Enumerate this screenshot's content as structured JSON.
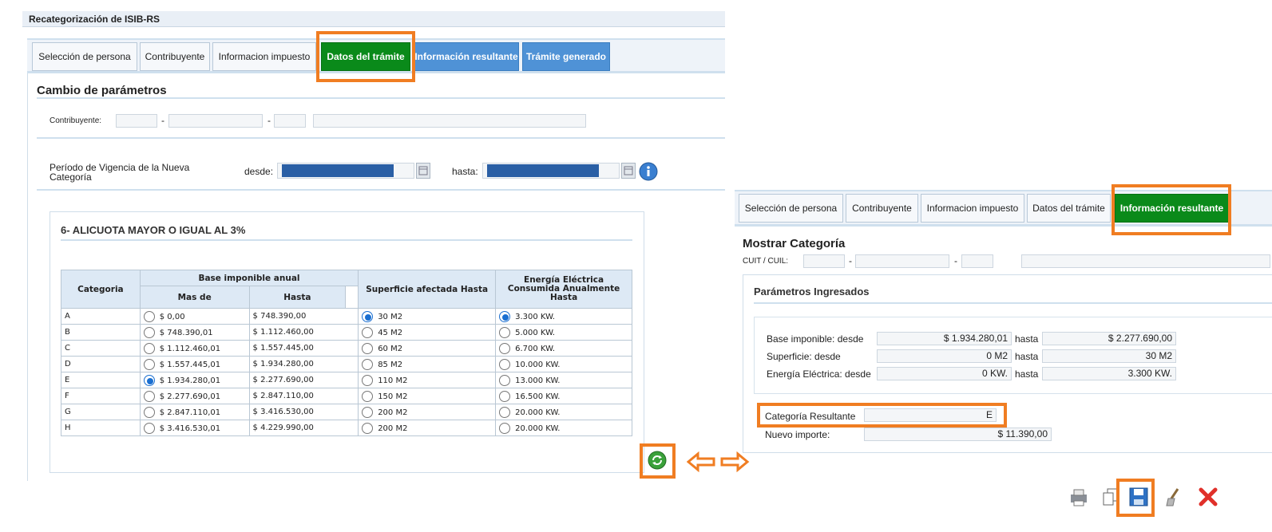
{
  "window_title": "Recategorización de ISIB-RS",
  "left": {
    "tabs": [
      {
        "label": "Selección de persona",
        "state": "normal"
      },
      {
        "label": "Contribuyente",
        "state": "normal"
      },
      {
        "label": "Informacion impuesto",
        "state": "normal"
      },
      {
        "label": "Datos del trámite",
        "state": "active"
      },
      {
        "label": "Información resultante",
        "state": "blue"
      },
      {
        "label": "Trámite generado",
        "state": "blue"
      }
    ],
    "section_title": "Cambio de parámetros",
    "contribuyente_label": "Contribuyente:",
    "separator": "-",
    "vigencia_label_1": "Período de Vigencia de la Nueva",
    "vigencia_label_2": "Categoría",
    "desde_label": "desde:",
    "hasta_label": "hasta:",
    "group_title": "6- ALICUOTA MAYOR O IGUAL AL 3%",
    "table": {
      "headers": {
        "categoria": "Categoria",
        "base": "Base imponible anual",
        "mas_de": "Mas de",
        "hasta": "Hasta",
        "superficie": "Superficie afectada Hasta",
        "energia_1": "Energía Eléctrica",
        "energia_2": "Consumida Anualmente",
        "energia_3": "Hasta"
      },
      "rows": [
        {
          "cat": "A",
          "mas_de": "$ 0,00",
          "hasta": "$ 748.390,00",
          "superficie": "30 M2",
          "energia": "3.300 KW."
        },
        {
          "cat": "B",
          "mas_de": "$ 748.390,01",
          "hasta": "$ 1.112.460,00",
          "superficie": "45 M2",
          "energia": "5.000 KW."
        },
        {
          "cat": "C",
          "mas_de": "$ 1.112.460,01",
          "hasta": "$ 1.557.445,00",
          "superficie": "60 M2",
          "energia": "6.700 KW."
        },
        {
          "cat": "D",
          "mas_de": "$ 1.557.445,01",
          "hasta": "$ 1.934.280,00",
          "superficie": "85 M2",
          "energia": "10.000 KW."
        },
        {
          "cat": "E",
          "mas_de": "$ 1.934.280,01",
          "hasta": "$ 2.277.690,00",
          "superficie": "110 M2",
          "energia": "13.000 KW."
        },
        {
          "cat": "F",
          "mas_de": "$ 2.277.690,01",
          "hasta": "$ 2.847.110,00",
          "superficie": "150 M2",
          "energia": "16.500 KW."
        },
        {
          "cat": "G",
          "mas_de": "$ 2.847.110,01",
          "hasta": "$ 3.416.530,00",
          "superficie": "200 M2",
          "energia": "20.000 KW."
        },
        {
          "cat": "H",
          "mas_de": "$ 3.416.530,01",
          "hasta": "$ 4.229.990,00",
          "superficie": "200 M2",
          "energia": "20.000 KW."
        }
      ]
    }
  },
  "right": {
    "tabs": [
      {
        "label": "Selección de persona",
        "state": "normal"
      },
      {
        "label": "Contribuyente",
        "state": "normal"
      },
      {
        "label": "Informacion impuesto",
        "state": "normal"
      },
      {
        "label": "Datos del trámite",
        "state": "normal"
      },
      {
        "label": "Información resultante",
        "state": "active"
      }
    ],
    "section_title": "Mostrar Categoría",
    "cuit_label": "CUIT / CUIL:",
    "separator": "-",
    "group_title": "Parámetros Ingresados",
    "base_label": "Base imponible: desde",
    "base_desde": "$ 1.934.280,01",
    "base_hasta": "$ 2.277.690,00",
    "superficie_label": "Superficie: desde",
    "superficie_desde": "0 M2",
    "superficie_hasta": "30 M2",
    "energia_label": "Energía Eléctrica: desde",
    "energia_desde": "0 KW.",
    "energia_hasta": "3.300 KW.",
    "hasta_label": "hasta",
    "categoria_label": "Categoría Resultante",
    "categoria_value": "E",
    "importe_label": "Nuevo importe:",
    "importe_value": "$ 11.390,00"
  },
  "toolbar_icons": [
    "print-icon",
    "copy-icon",
    "save-icon",
    "clear-icon",
    "close-icon"
  ],
  "colors": {
    "active_tab": "#0a8a1a",
    "blue_tab": "#4f92d6",
    "highlight": "#f07d22",
    "date_fill": "#2a5fa5"
  }
}
